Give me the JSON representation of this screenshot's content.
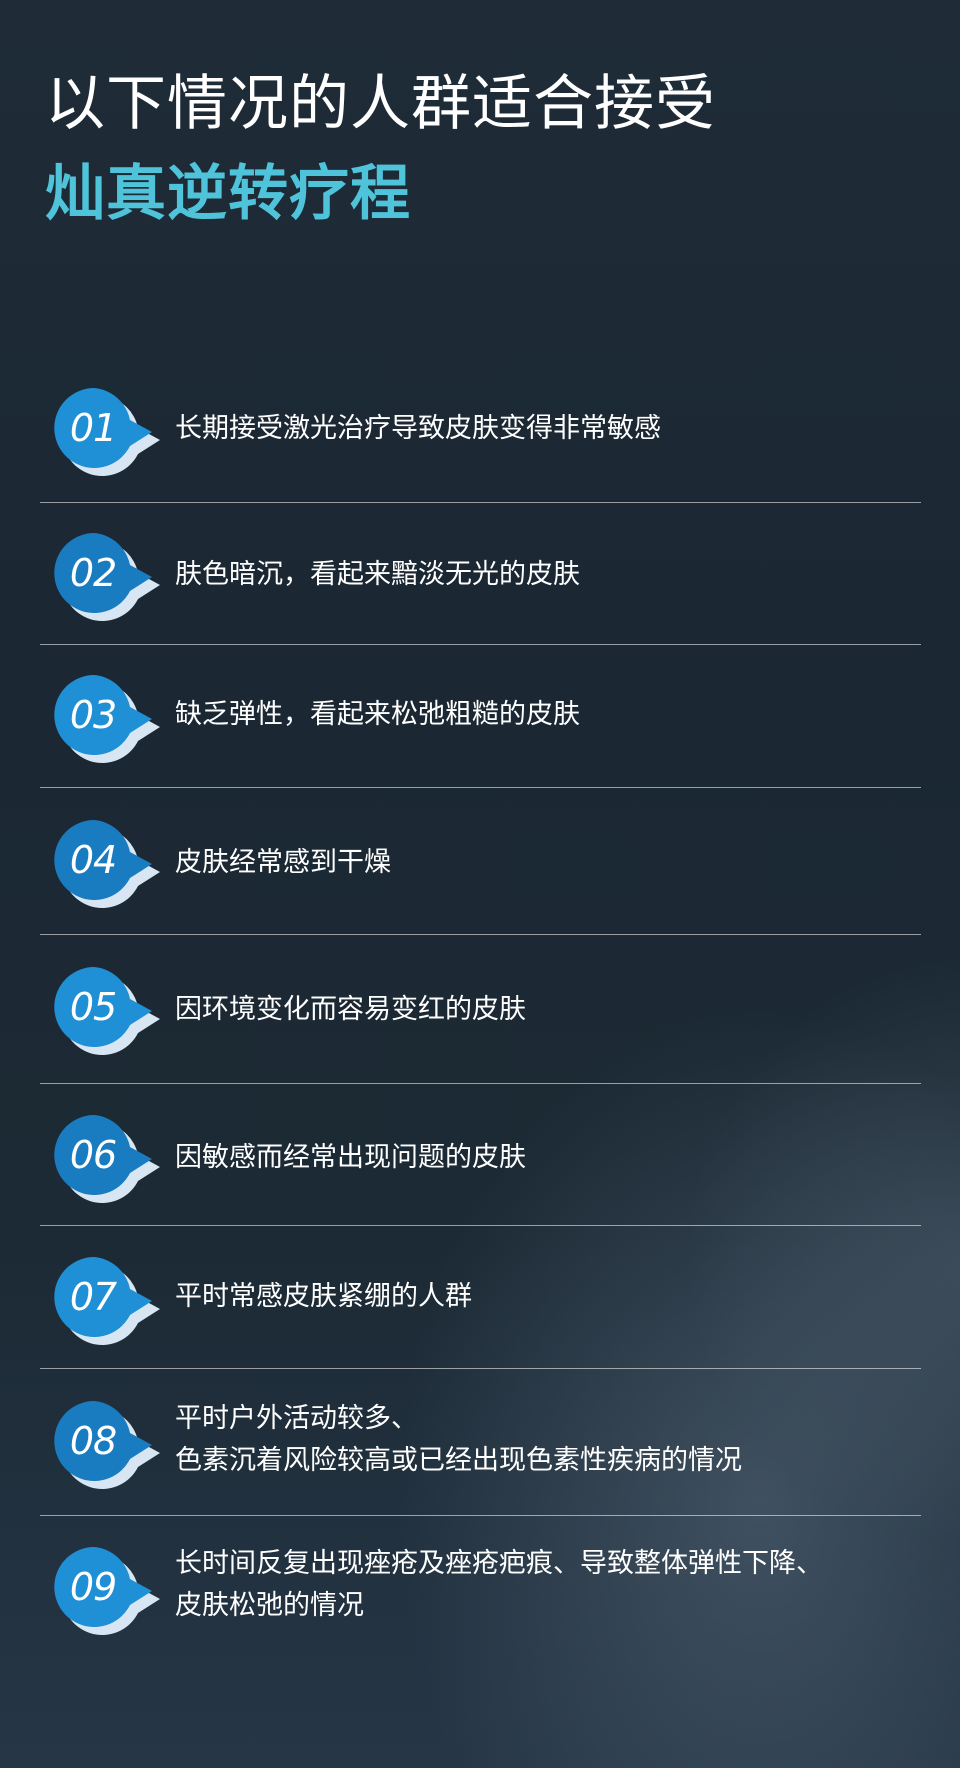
{
  "title": {
    "line1": "以下情况的人群适合接受",
    "line2": "灿真逆转疗程"
  },
  "colors": {
    "accent": "#4fc3d9",
    "badge_fill": "#1f8fd6",
    "badge_shadow": "#d7e6f2",
    "background": "#1b2a36"
  },
  "items": [
    {
      "number": "01",
      "text_line1": "长期接受激光治疗导致皮肤变得非常敏感",
      "text_line2": ""
    },
    {
      "number": "02",
      "text_line1": "肤色暗沉，看起来黯淡无光的皮肤",
      "text_line2": ""
    },
    {
      "number": "03",
      "text_line1": "缺乏弹性，看起来松弛粗糙的皮肤",
      "text_line2": ""
    },
    {
      "number": "04",
      "text_line1": "皮肤经常感到干燥",
      "text_line2": ""
    },
    {
      "number": "05",
      "text_line1": "因环境变化而容易变红的皮肤",
      "text_line2": ""
    },
    {
      "number": "06",
      "text_line1": "因敏感而经常出现问题的皮肤",
      "text_line2": ""
    },
    {
      "number": "07",
      "text_line1": "平时常感皮肤紧绷的人群",
      "text_line2": ""
    },
    {
      "number": "08",
      "text_line1": "平时户外活动较多、",
      "text_line2": "色素沉着风险较高或已经出现色素性疾病的情况"
    },
    {
      "number": "09",
      "text_line1": "长时间反复出现痤疮及痤疮疤痕、导致整体弹性下降、",
      "text_line2": "皮肤松弛的情况"
    }
  ]
}
